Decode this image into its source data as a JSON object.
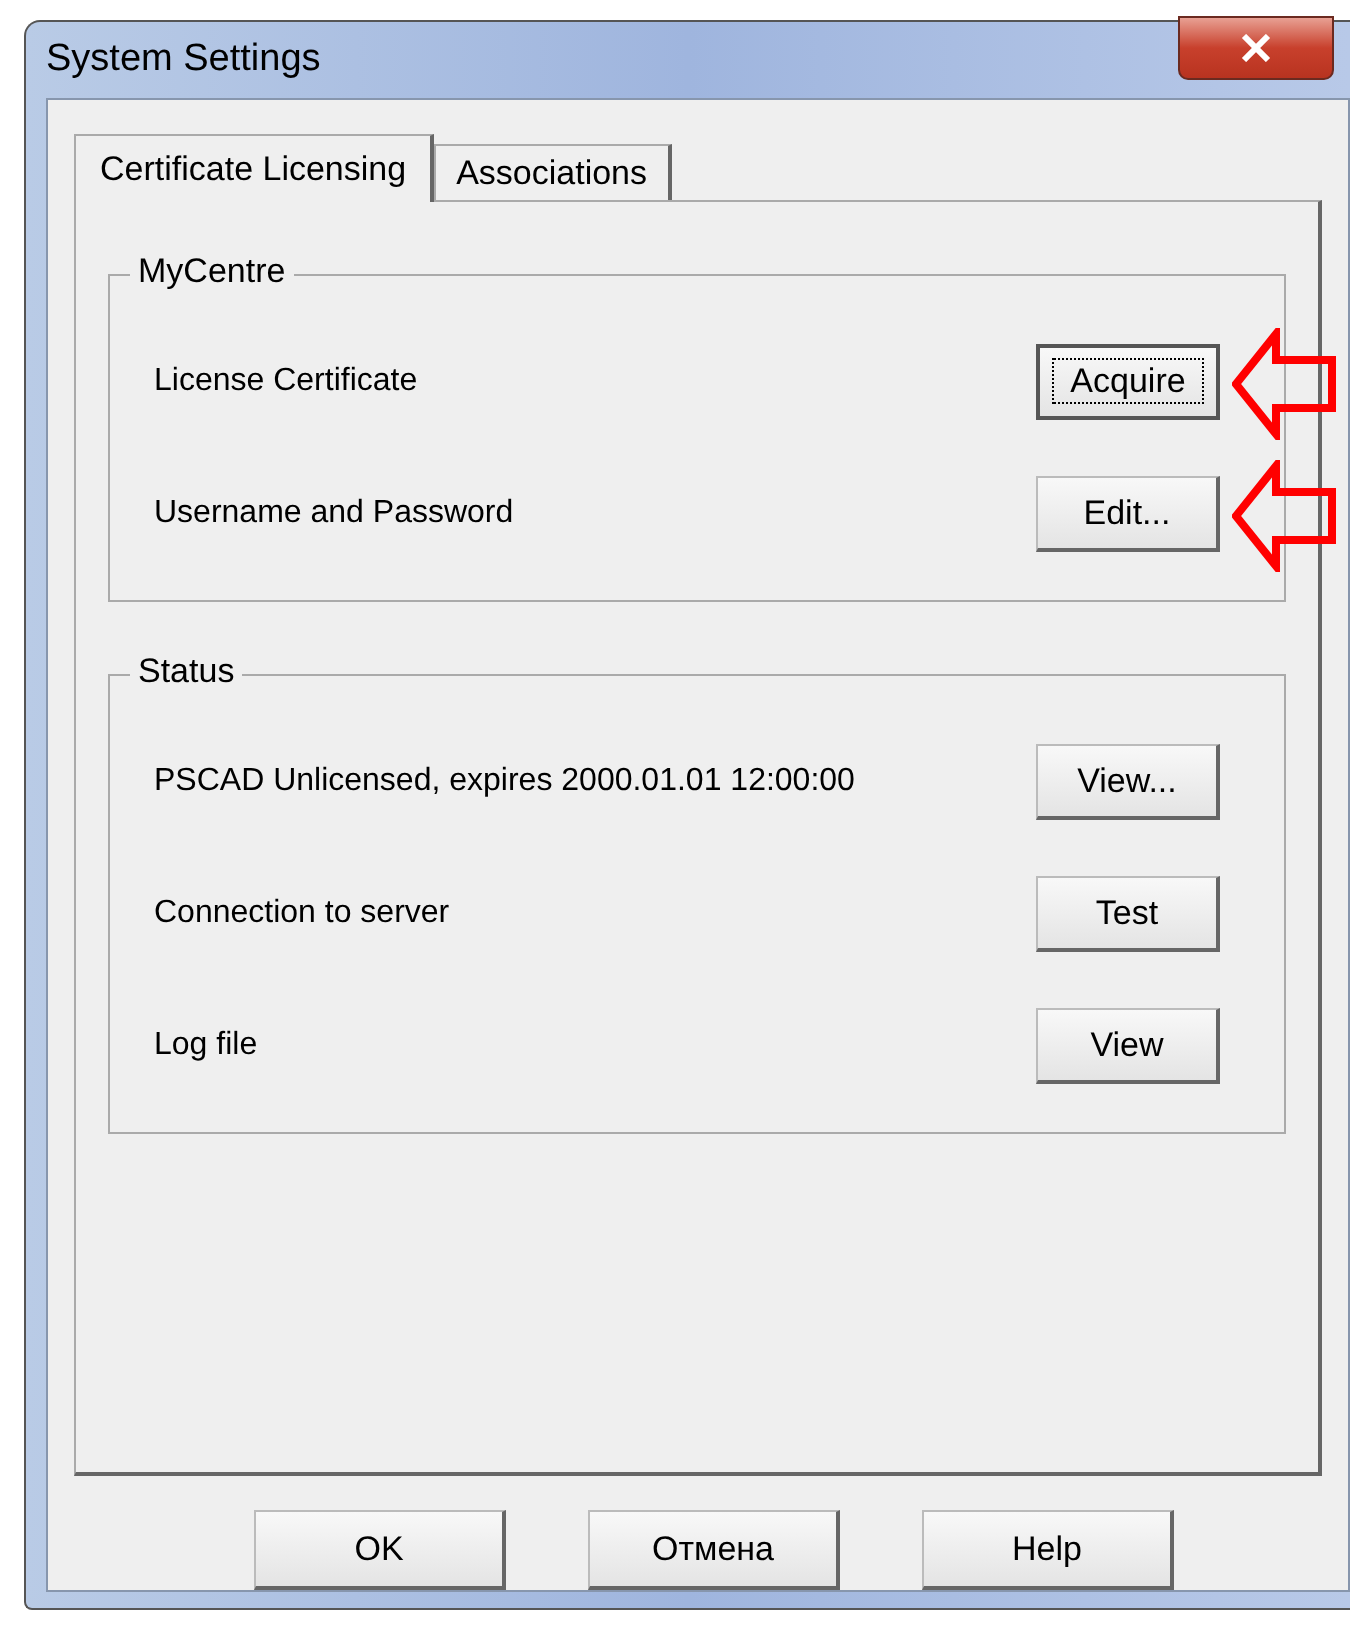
{
  "window": {
    "title": "System Settings"
  },
  "tabs": [
    {
      "label": "Certificate Licensing",
      "selected": true
    },
    {
      "label": "Associations",
      "selected": false
    }
  ],
  "groups": [
    {
      "title": "MyCentre",
      "rows": [
        {
          "label": "License Certificate",
          "button": "Acquire",
          "focused": true,
          "annotated": true
        },
        {
          "label": "Username and Password",
          "button": "Edit...",
          "focused": false,
          "annotated": true
        }
      ]
    },
    {
      "title": "Status",
      "rows": [
        {
          "label": "PSCAD Unlicensed, expires 2000.01.01 12:00:00",
          "button": "View...",
          "focused": false,
          "annotated": false
        },
        {
          "label": "Connection to server",
          "button": "Test",
          "focused": false,
          "annotated": false
        },
        {
          "label": "Log file",
          "button": "View",
          "focused": false,
          "annotated": false
        }
      ]
    }
  ],
  "buttons": [
    "OK",
    "Отмена",
    "Help"
  ]
}
